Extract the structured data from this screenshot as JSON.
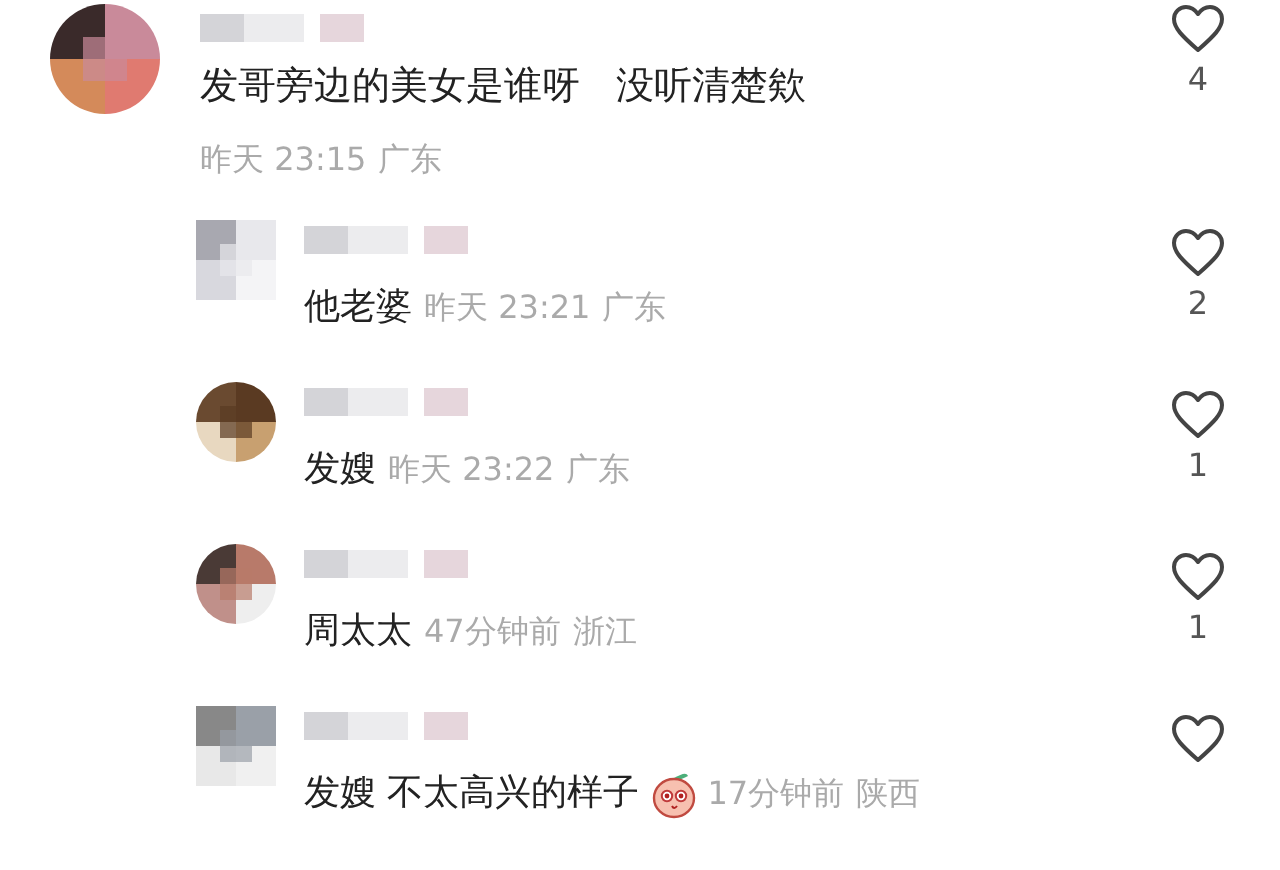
{
  "comment": {
    "text": "发哥旁边的美女是谁呀   没听清楚欸",
    "time": "昨天 23:15",
    "location": "广东",
    "likes": "4"
  },
  "replies": [
    {
      "text": "他老婆",
      "time": "昨天 23:21",
      "location": "广东",
      "likes": "2",
      "emoji": false
    },
    {
      "text": "发嫂",
      "time": "昨天 23:22",
      "location": "广东",
      "likes": "1",
      "emoji": false
    },
    {
      "text": "周太太",
      "time": "47分钟前",
      "location": "浙江",
      "likes": "1",
      "emoji": false
    },
    {
      "text": "发嫂 不太高兴的样子",
      "time": "17分钟前",
      "location": "陕西",
      "emoji": true
    }
  ]
}
